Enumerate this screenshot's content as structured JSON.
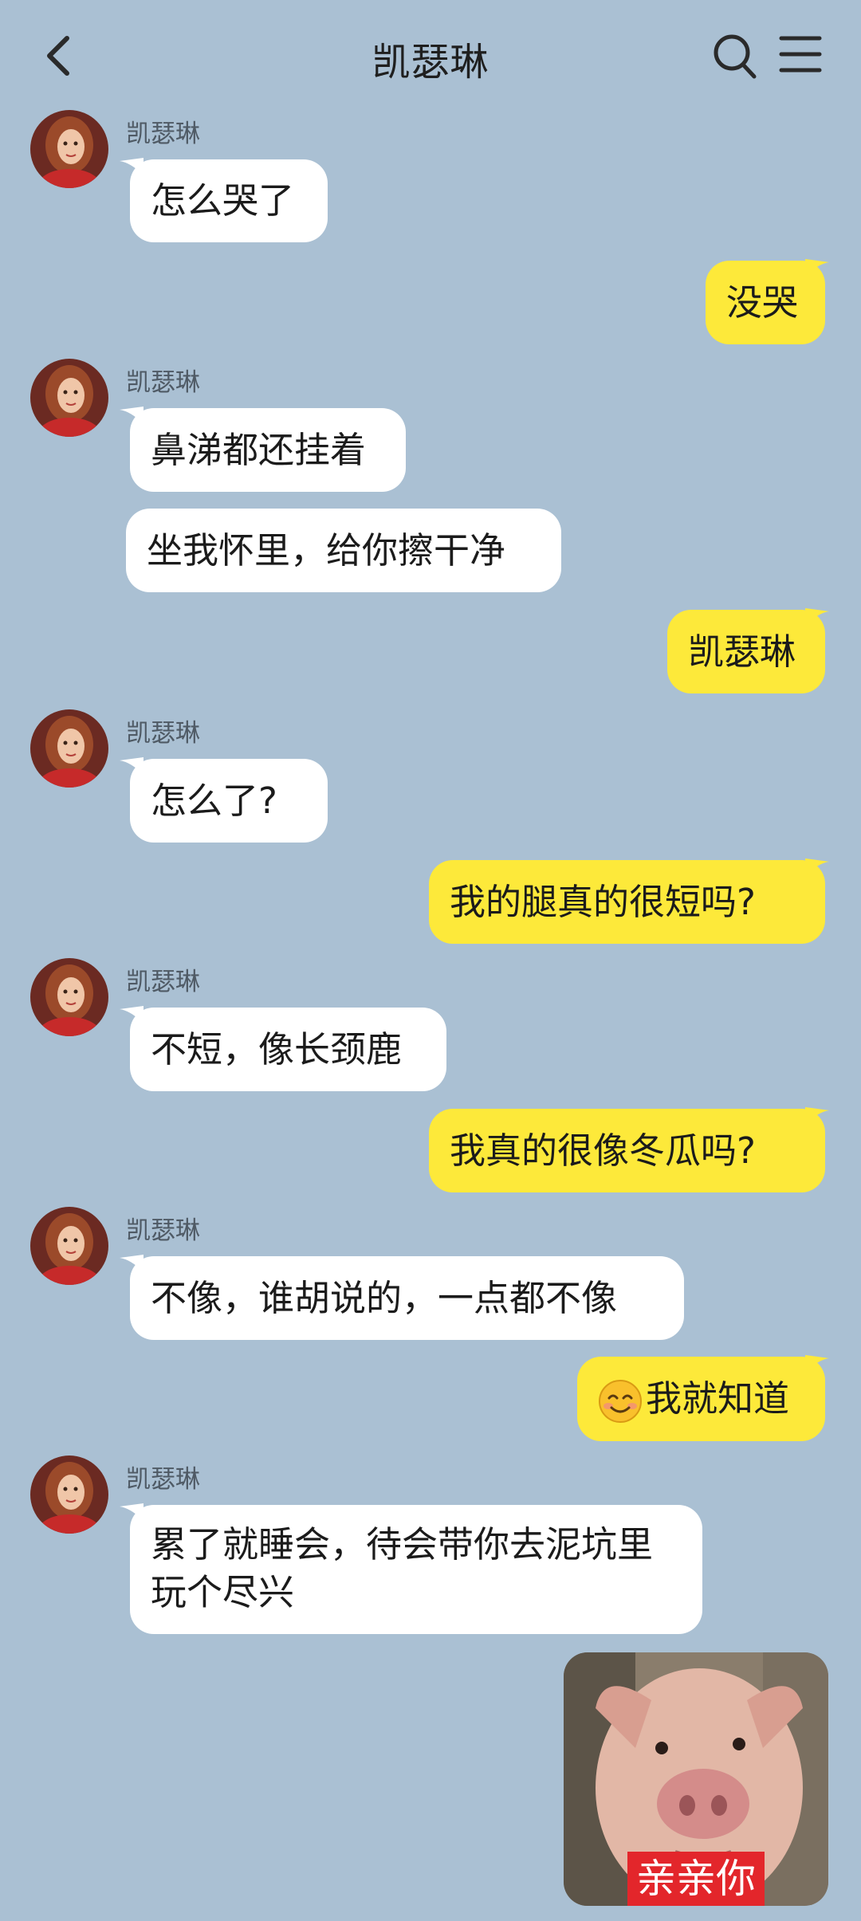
{
  "header": {
    "title": "凯瑟琳",
    "back_icon": "chevron-left-icon",
    "search_icon": "search-icon",
    "menu_icon": "menu-icon"
  },
  "messages": [
    {
      "side": "in",
      "sender": "凯瑟琳",
      "text": "怎么哭了"
    },
    {
      "side": "out",
      "text": "没哭"
    },
    {
      "side": "in",
      "sender": "凯瑟琳",
      "text": "鼻涕都还挂着"
    },
    {
      "side": "in",
      "text": "坐我怀里，给你擦干净"
    },
    {
      "side": "out",
      "text": "凯瑟琳"
    },
    {
      "side": "in",
      "sender": "凯瑟琳",
      "text": "怎么了?"
    },
    {
      "side": "out",
      "text": "我的腿真的很短吗?"
    },
    {
      "side": "in",
      "sender": "凯瑟琳",
      "text": "不短，像长颈鹿"
    },
    {
      "side": "out",
      "text": "我真的很像冬瓜吗?"
    },
    {
      "side": "in",
      "sender": "凯瑟琳",
      "text": "不像，谁胡说的，一点都不像"
    },
    {
      "side": "out",
      "emoji": "smiling-face-emoji",
      "text": "我就知道"
    },
    {
      "side": "in",
      "sender": "凯瑟琳",
      "text": "累了就睡会，待会带你去泥坑里玩个尽兴"
    },
    {
      "side": "out",
      "sticker": "pig-sticker",
      "caption": "亲亲你"
    }
  ],
  "colors": {
    "background": "#aac0d3",
    "incoming_bubble": "#ffffff",
    "outgoing_bubble": "#fde93a",
    "sticker_caption_bg": "#e3262b"
  }
}
